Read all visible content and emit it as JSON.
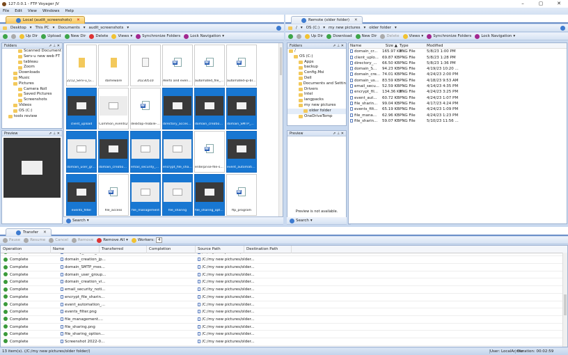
{
  "window": {
    "title": "127.0.0.1 - FTP Voyager JV",
    "minimize": "–",
    "maximize": "▢",
    "close": "✕"
  },
  "menu": [
    "File",
    "Edit",
    "View",
    "Windows",
    "Help"
  ],
  "local": {
    "tab": "Local (audit_screenshots)",
    "breadcrumb": [
      "Desktop",
      "This PC",
      "Documents",
      "audit_screenshots"
    ],
    "toolbar": {
      "updir": "Up Dir",
      "upload": "Upload",
      "newdir": "New Dir",
      "delete": "Delete",
      "views": "Views",
      "sync": "Synchronize Folders",
      "lock": "Lock Navigation"
    },
    "folders_title": "Folders",
    "preview_title": "Preview",
    "search": "Search",
    "tree": [
      {
        "label": "Scanned Document",
        "d": 3
      },
      {
        "label": "Serv-u new web FT",
        "d": 3
      },
      {
        "label": "tableau",
        "d": 3
      },
      {
        "label": "Zoom",
        "d": 3
      },
      {
        "label": "Downloads",
        "d": 2
      },
      {
        "label": "Music",
        "d": 2
      },
      {
        "label": "Pictures",
        "d": 2
      },
      {
        "label": "Camera Roll",
        "d": 3
      },
      {
        "label": "Saved Pictures",
        "d": 3
      },
      {
        "label": "Screenshots",
        "d": 3
      },
      {
        "label": "Videos",
        "d": 2
      },
      {
        "label": "OS (C:)",
        "d": 2
      },
      {
        "label": "tools review",
        "d": 1
      }
    ],
    "tiles": [
      {
        "name": "2212_Serv-u_Gat...",
        "kind": "folder",
        "sel": false
      },
      {
        "name": "dameware",
        "kind": "folder",
        "sel": false
      },
      {
        "name": "20230510",
        "kind": "text",
        "sel": false
      },
      {
        "name": "Alerts and events ...",
        "kind": "word",
        "sel": false
      },
      {
        "name": "automated_file_tr...",
        "kind": "word",
        "sel": false
      },
      {
        "name": "automated-ip-bloc...",
        "kind": "word",
        "sel": false
      },
      {
        "name": "client_upload",
        "kind": "shot",
        "sel": true
      },
      {
        "name": "Common_events2",
        "kind": "shotlight",
        "sel": false
      },
      {
        "name": "desktop-mobile-ac...",
        "kind": "word",
        "sel": false
      },
      {
        "name": "directory_acces_rule",
        "kind": "shot",
        "sel": true
      },
      {
        "name": "domain_creation_jp",
        "kind": "shot",
        "sel": true
      },
      {
        "name": "domain_SMTP_me...",
        "kind": "shot",
        "sel": true
      },
      {
        "name": "domain_user_grou...",
        "kind": "shotlight",
        "sel": true
      },
      {
        "name": "domain_creation_...",
        "kind": "shot",
        "sel": true
      },
      {
        "name": "email_security_notif",
        "kind": "shotlight",
        "sel": true
      },
      {
        "name": "encrypt_file_sharing",
        "kind": "shotlight",
        "sel": true
      },
      {
        "name": "enterprise-file-sha...",
        "kind": "word",
        "sel": false
      },
      {
        "name": "event_automation...",
        "kind": "shot",
        "sel": true
      },
      {
        "name": "events_filter",
        "kind": "shot",
        "sel": true
      },
      {
        "name": "file_access",
        "kind": "word",
        "sel": false
      },
      {
        "name": "file_management",
        "kind": "shotlight",
        "sel": true
      },
      {
        "name": "file_sharing",
        "kind": "shotlight",
        "sel": true
      },
      {
        "name": "file_sharing_options",
        "kind": "shot",
        "sel": true
      },
      {
        "name": "ftp_program",
        "kind": "word",
        "sel": false
      }
    ]
  },
  "remote": {
    "tab": "Remote (older folder)",
    "breadcrumb": [
      "/",
      "OS (C:)",
      "my new pictures",
      "older folder"
    ],
    "toolbar": {
      "updir": "Up Dir",
      "download": "Download",
      "newdir": "New Dir",
      "delete": "Delete",
      "views": "Views",
      "sync": "Synchronize Folders",
      "lock": "Lock Navigation"
    },
    "folders_title": "Folders",
    "preview_title": "Preview",
    "preview_empty": "Preview is not available.",
    "search": "Search",
    "tree": [
      {
        "label": "/",
        "d": 0
      },
      {
        "label": "OS (C:)",
        "d": 1
      },
      {
        "label": "Apps",
        "d": 2
      },
      {
        "label": "backup",
        "d": 2
      },
      {
        "label": "Config.Msi",
        "d": 2
      },
      {
        "label": "Dell",
        "d": 2
      },
      {
        "label": "Documents and Settin",
        "d": 2
      },
      {
        "label": "Drivers",
        "d": 2
      },
      {
        "label": "Intel",
        "d": 2
      },
      {
        "label": "langpacks",
        "d": 2
      },
      {
        "label": "my new pictures",
        "d": 2
      },
      {
        "label": "older folder",
        "d": 3
      },
      {
        "label": "OneDriveTemp",
        "d": 2
      }
    ],
    "columns": [
      "Name",
      "Size ▲",
      "Type",
      "Modified"
    ],
    "files": [
      [
        "domain_cr...",
        "165.97 KB",
        "PNG File",
        "5/8/23 1:00 PM"
      ],
      [
        "client_uplo...",
        "69.87 KB",
        "PNG File",
        "5/8/23 1:28 PM"
      ],
      [
        "directory_...",
        "66.50 KB",
        "PNG File",
        "5/8/23 1:36 PM"
      ],
      [
        "domain_S...",
        "94.23 KB",
        "PNG File",
        "4/19/23 10:20 ..."
      ],
      [
        "domain_cre...",
        "74.01 KB",
        "PNG File",
        "4/24/23 2:00 PM"
      ],
      [
        "domain_us...",
        "83.59 KB",
        "PNG File",
        "4/18/23 9:53 AM"
      ],
      [
        "email_secu...",
        "52.59 KB",
        "PNG File",
        "4/14/23 4:35 PM"
      ],
      [
        "encrypt_fil...",
        "134.36 KB",
        "PNG File",
        "4/24/23 3:25 PM"
      ],
      [
        "event_aut...",
        "60.72 KB",
        "PNG File",
        "4/24/23 1:07 PM"
      ],
      [
        "file_sharin...",
        "99.04 KB",
        "PNG File",
        "4/17/23 4:24 PM"
      ],
      [
        "events_filt...",
        "65.19 KB",
        "PNG File",
        "4/24/23 1:09 PM"
      ],
      [
        "file_mana...",
        "62.96 KB",
        "PNG File",
        "4/24/23 1:23 PM"
      ],
      [
        "file_sharin...",
        "59.07 KB",
        "PNG File",
        "5/10/23 11:56 ..."
      ]
    ]
  },
  "transfer": {
    "tab": "Transfer",
    "toolbar": {
      "pause": "Pause",
      "resume": "Resume",
      "cancel": "Cancel",
      "remove": "Remove",
      "removeall": "Remove All",
      "workers_label": "Workers:",
      "workers": "4"
    },
    "columns": [
      "Operation",
      "Name",
      "Transferred",
      "Completion",
      "Source Path",
      "Destination Path"
    ],
    "rows": [
      [
        "Complete",
        "directory_acces_rul...",
        "/C:/my new pictures/older..."
      ],
      [
        "Complete",
        "domain_creation_jp...",
        "/C:/my new pictures/older..."
      ],
      [
        "Complete",
        "domain_SMTP_mes...",
        "/C:/my new pictures/older..."
      ],
      [
        "Complete",
        "domain_user_group...",
        "/C:/my new pictures/older..."
      ],
      [
        "Complete",
        "domain_creation_vi...",
        "/C:/my new pictures/older..."
      ],
      [
        "Complete",
        "email_security_noti...",
        "/C:/my new pictures/older..."
      ],
      [
        "Complete",
        "encrypt_file_sharin...",
        "/C:/my new pictures/older..."
      ],
      [
        "Complete",
        "event_automation_...",
        "/C:/my new pictures/older..."
      ],
      [
        "Complete",
        "events_filter.png",
        "/C:/my new pictures/older..."
      ],
      [
        "Complete",
        "file_management....",
        "/C:/my new pictures/older..."
      ],
      [
        "Complete",
        "file_sharing.png",
        "/C:/my new pictures/older..."
      ],
      [
        "Complete",
        "file_sharing_option...",
        "/C:/my new pictures/older..."
      ],
      [
        "Complete",
        "Screenshot 2022-0...",
        "/C:/my new pictures/older..."
      ]
    ]
  },
  "status": {
    "left": "13 item(s).  (/C:/my new pictures/older folder/)",
    "user": "User:  LocalAdmin",
    "duration": "Duration:  00:02:59"
  }
}
